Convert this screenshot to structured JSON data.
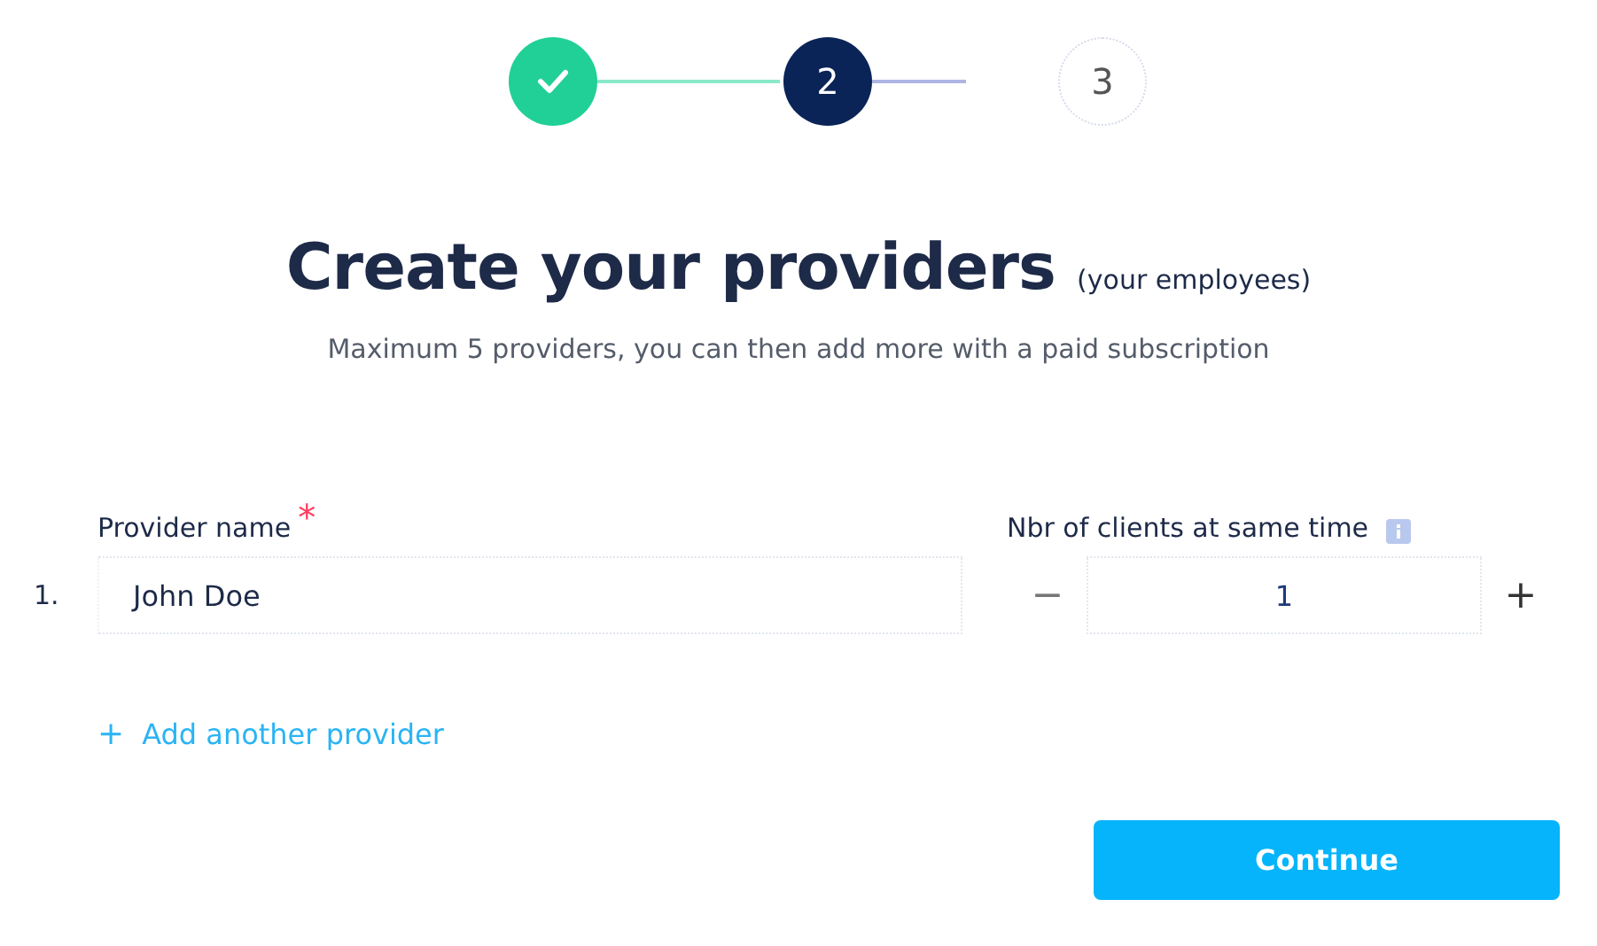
{
  "steps": [
    {
      "done": true,
      "current": false
    },
    {
      "label": "2",
      "done": false,
      "current": true
    },
    {
      "label": "3",
      "done": false,
      "current": false
    }
  ],
  "title": "Create your providers",
  "title_note": "(your employees)",
  "subtitle": "Maximum 5 providers, you can then add more with a paid subscription",
  "name_label": "Provider name",
  "required_mark": "*",
  "clients_label": "Nbr of clients at same time",
  "providers": [
    {
      "number": "1.",
      "name": "John Doe",
      "clients": "1",
      "minus": "−",
      "plus": "+"
    }
  ],
  "add_link": {
    "icon": "+",
    "label": "Add another provider"
  },
  "continue_button": "Continue"
}
